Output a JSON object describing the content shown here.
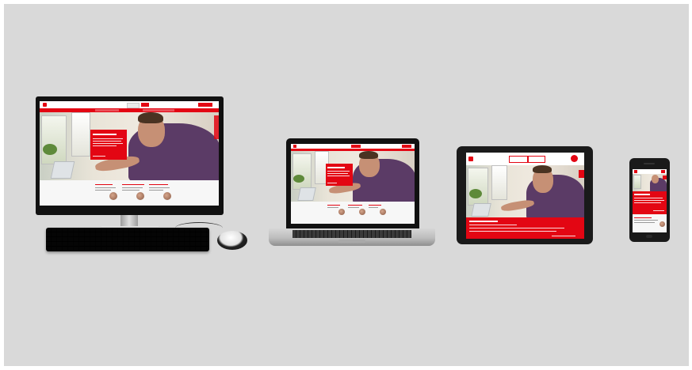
{
  "devices": [
    {
      "name": "desktop"
    },
    {
      "name": "laptop"
    },
    {
      "name": "tablet"
    },
    {
      "name": "smartphone"
    }
  ],
  "colors": {
    "background": "#d9d9d9",
    "brand_red": "#e30613",
    "bezel_black": "#111111",
    "aluminum": "#c8c8c8"
  },
  "icons": [
    "monitor-icon",
    "keyboard-icon",
    "mouse-icon",
    "laptop-icon",
    "tablet-icon",
    "smartphone-icon"
  ]
}
